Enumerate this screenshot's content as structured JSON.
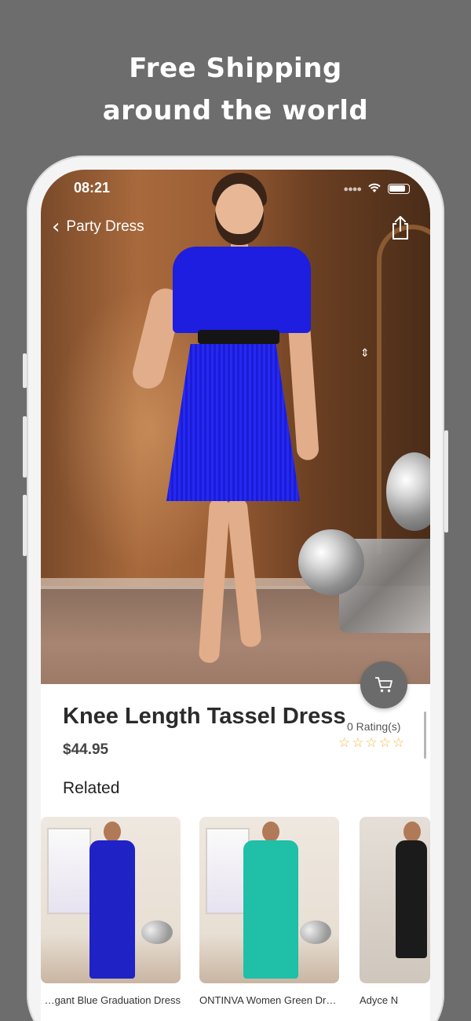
{
  "promo": {
    "line1": "Free Shipping",
    "line2": "around the world"
  },
  "status_bar": {
    "time": "08:21"
  },
  "nav": {
    "back_label": "Party Dress"
  },
  "product": {
    "title": "Knee Length Tassel Dress",
    "price": "$44.95",
    "rating_label": "0 Rating(s)",
    "rating_stars": 0,
    "rating_max": 5
  },
  "related": {
    "heading": "Related",
    "items": [
      {
        "caption": "Elegant Blue Graduation Dress",
        "dress_color": "#1f22c4"
      },
      {
        "caption": "ONTINVA Women Green Dress",
        "dress_color": "#1fbfa8"
      },
      {
        "caption": "Adyce N",
        "dress_color": "#1b1b1b"
      }
    ]
  },
  "colors": {
    "background": "#6d6d6d",
    "accent_star": "#f3b640",
    "cart_button": "#6b6b6b",
    "dress": "#1d1ee0"
  },
  "icons": {
    "back": "chevron-left-icon",
    "share": "share-icon",
    "cart": "cart-icon"
  }
}
